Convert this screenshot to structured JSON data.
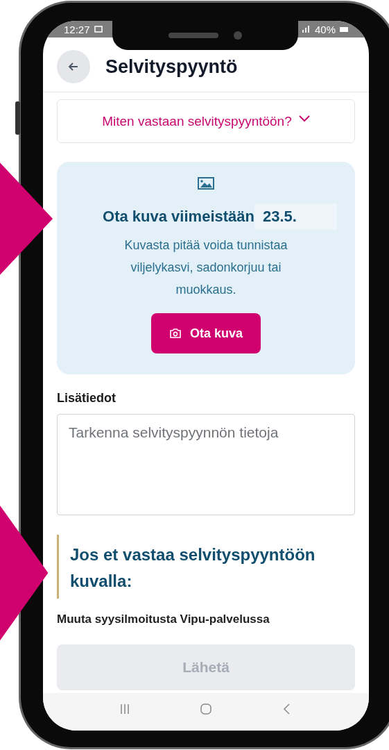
{
  "status_bar": {
    "time": "12:27",
    "battery": "40%"
  },
  "header": {
    "title": "Selvityspyyntö"
  },
  "accordion": {
    "label": "Miten vastaan selvityspyyntöön?",
    "expanded": false
  },
  "photo_card": {
    "heading": "Ota kuva viimeistään",
    "date": "23.5.",
    "description": "Kuvasta pitää voida tunnistaa viljelykasvi, sadonkorjuu tai muokkaus.",
    "button": "Ota kuva"
  },
  "details": {
    "label": "Lisätiedot",
    "placeholder": "Tarkenna selvityspyynnön tietoja"
  },
  "alternative": {
    "heading": "Jos et vastaa selvityspyyntöön kuvalla:",
    "text": "Muuta syysilmoitusta Vipu-palvelussa"
  },
  "submit": {
    "label": "Lähetä",
    "disabled": true
  }
}
